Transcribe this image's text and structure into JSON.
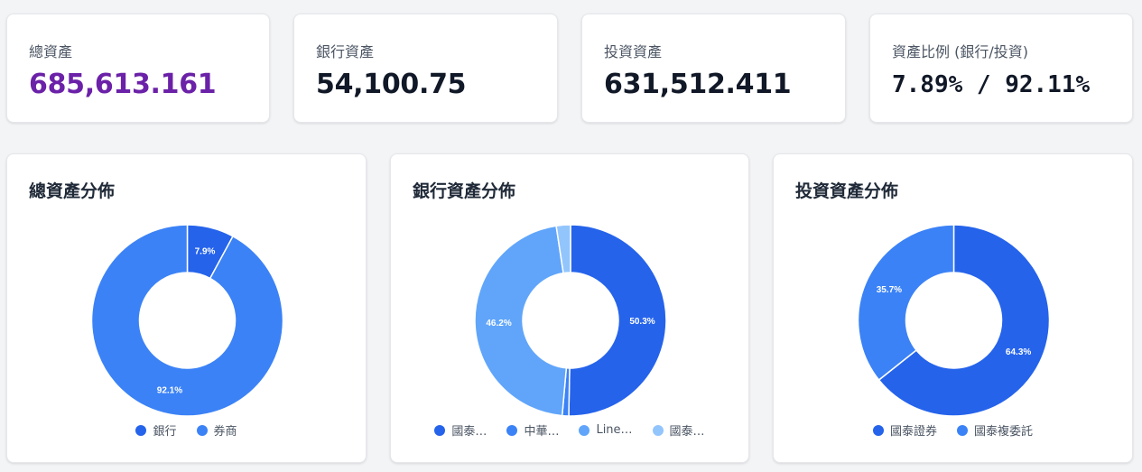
{
  "stats": [
    {
      "label": "總資產",
      "value": "685,613.161"
    },
    {
      "label": "銀行資產",
      "value": "54,100.75"
    },
    {
      "label": "投資資產",
      "value": "631,512.411"
    },
    {
      "label": "資產比例 (銀行/投資)",
      "value": "7.89% / 92.11%"
    }
  ],
  "colors": {
    "accent_purple": "#6b21a8",
    "blue_dark": "#2563eb",
    "blue_mid": "#3b82f6",
    "blue_light": "#60a5fa",
    "blue_pale": "#93c5fd"
  },
  "chart_data": [
    {
      "type": "pie",
      "title": "總資產分佈",
      "categories": [
        "銀行",
        "券商"
      ],
      "values": [
        7.9,
        92.1
      ],
      "labels": [
        "7.9%",
        "92.1%"
      ],
      "colors": [
        "#2563eb",
        "#3b82f6"
      ],
      "legend_labels": [
        "銀行",
        "券商"
      ],
      "legend": "bottom"
    },
    {
      "type": "pie",
      "title": "銀行資產分佈",
      "categories": [
        "國泰…",
        "中華…",
        "Line…",
        "國泰…"
      ],
      "values": [
        50.3,
        1.1,
        46.2,
        2.4
      ],
      "labels": [
        "50.3%",
        "",
        "46.2%",
        ""
      ],
      "colors": [
        "#2563eb",
        "#3b82f6",
        "#60a5fa",
        "#93c5fd"
      ],
      "legend_labels": [
        "國泰…",
        "中華…",
        "Line…",
        "國泰…"
      ],
      "legend": "bottom"
    },
    {
      "type": "pie",
      "title": "投資資產分佈",
      "categories": [
        "國泰證券",
        "國泰複委託"
      ],
      "values": [
        64.3,
        35.7
      ],
      "labels": [
        "64.3%",
        "35.7%"
      ],
      "colors": [
        "#2563eb",
        "#3b82f6"
      ],
      "legend_labels": [
        "國泰證券",
        "國泰複委託"
      ],
      "legend": "bottom"
    }
  ]
}
